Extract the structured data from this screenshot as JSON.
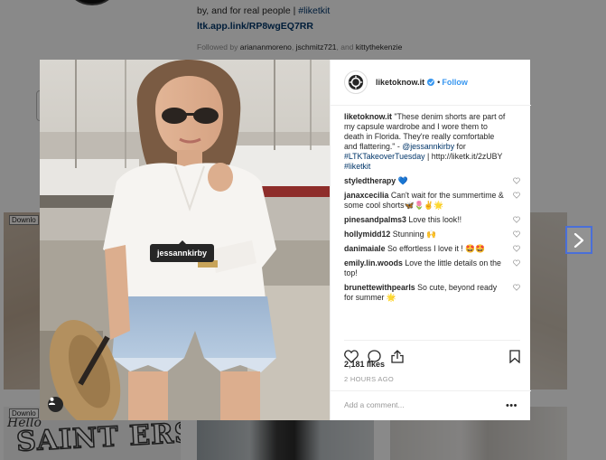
{
  "profile": {
    "bio_line_1": "by, and for real people |",
    "bio_hashtag": "#liketkit",
    "bio_link": "ltk.app.link/RP8wgEQ7RR",
    "followed_by_prefix": "Followed by",
    "followed_by_1": "ariananmoreno",
    "followed_by_2": "jschmitz721",
    "followed_by_and": ", and",
    "followed_by_3": "kittythekenzie"
  },
  "grid": {
    "download_label": "Downlo",
    "tile_3_script": "Hello",
    "tile_3_text": "SAINT ERSBURG"
  },
  "post": {
    "photo_tag": "jessannkirby",
    "account": "liketoknow.it",
    "follow_label": "Follow",
    "dot": "•",
    "caption": {
      "user": "liketoknow.it",
      "text": "\"These denim shorts are part of my capsule wardrobe and I wore them to death in Florida. They're really comfortable and flattering.\" -",
      "mention": "@jessannkirby",
      "mid": "for",
      "hashtag_1": "#LTKTakeoverTuesday",
      "sep": "|",
      "url": "http://liketk.it/2zUBY",
      "hashtag_2": "#liketkit"
    },
    "comments": [
      {
        "user": "styledtherapy",
        "text": "💙"
      },
      {
        "user": "janaxcecilia",
        "text": "Can't wait for the summertime & some cool shorts🦋🌷✌🌟"
      },
      {
        "user": "pinesandpalms3",
        "text": "Love this look!!"
      },
      {
        "user": "hollymidd12",
        "text": "Stunning 🙌"
      },
      {
        "user": "danimaiale",
        "text": "So effortless I love it ! 🤩🤩"
      },
      {
        "user": "emily.lin.woods",
        "text": "Love the little details on the top!"
      },
      {
        "user": "brunettewithpearls",
        "text": "So cute, beyond ready for summer 🌟"
      }
    ],
    "likes": "2,181 likes",
    "timestamp": "2 HOURS AGO",
    "add_comment_placeholder": "Add a comment...",
    "more_label": "•••"
  },
  "colors": {
    "link": "#003569",
    "accent": "#3897f0",
    "focus_border": "#4a6fd8"
  }
}
